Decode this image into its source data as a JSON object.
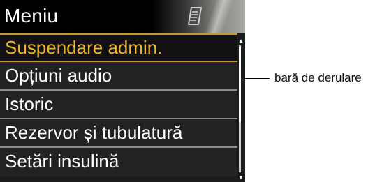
{
  "header": {
    "title": "Meniu",
    "icon": "document-icon"
  },
  "menu": {
    "items": [
      {
        "label": "Suspendare admin.",
        "selected": true
      },
      {
        "label": "Opțiuni audio",
        "selected": false
      },
      {
        "label": "Istoric",
        "selected": false
      },
      {
        "label": "Rezervor și tubulatură",
        "selected": false
      },
      {
        "label": "Setări insulină",
        "selected": false
      }
    ]
  },
  "scrollbar": {
    "position": 0
  },
  "annotation": {
    "label": "bară de derulare"
  },
  "colors": {
    "selected_text": "#f0b429",
    "selected_border": "#c69a2c",
    "item_text": "#ffffff",
    "background": "#1c1c1c",
    "header": "#000000"
  }
}
